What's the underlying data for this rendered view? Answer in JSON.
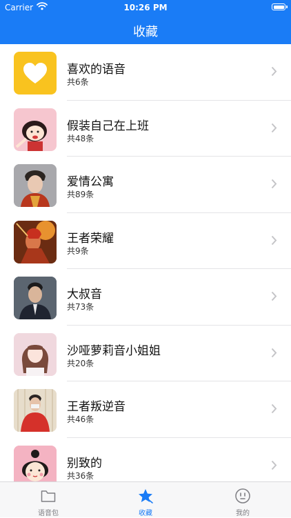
{
  "status_bar": {
    "carrier": "Carrier",
    "time": "10:26 PM"
  },
  "nav": {
    "title": "收藏"
  },
  "collections": [
    {
      "name": "喜欢的语音",
      "count": "共6条",
      "thumb": "heart-icon"
    },
    {
      "name": "假装自己在上班",
      "count": "共48条",
      "thumb": "cartoon-girl"
    },
    {
      "name": "爱情公寓",
      "count": "共89条",
      "thumb": "costume-portrait"
    },
    {
      "name": "王者荣耀",
      "count": "共9条",
      "thumb": "game-art"
    },
    {
      "name": "大叔音",
      "count": "共73条",
      "thumb": "man-in-suit"
    },
    {
      "name": "沙哑萝莉音小姐姐",
      "count": "共20条",
      "thumb": "girl-portrait"
    },
    {
      "name": "王者叛逆音",
      "count": "共46条",
      "thumb": "boy-red-sweater"
    },
    {
      "name": "别致的",
      "count": "共36条",
      "thumb": "cartoon-character"
    }
  ],
  "tabs": [
    {
      "label": "语音包",
      "icon": "folder-icon",
      "active": false
    },
    {
      "label": "收藏",
      "icon": "star-icon",
      "active": true
    },
    {
      "label": "我的",
      "icon": "face-icon",
      "active": false
    }
  ],
  "colors": {
    "accent": "#1a7cf6",
    "inactive": "#7e7e83",
    "heart_bg": "#f9c31f"
  }
}
